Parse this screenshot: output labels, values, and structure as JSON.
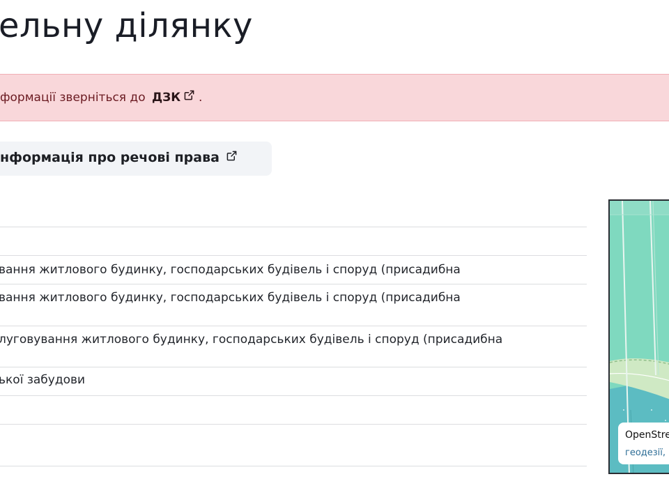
{
  "page": {
    "title": "ельну ділянку"
  },
  "alert": {
    "text": "формації зверніться до",
    "link_label": "ДЗК",
    "trailing": ".",
    "icon": "external-link-icon"
  },
  "rights_link": {
    "label": "нформація про речові права",
    "icon": "external-link-icon"
  },
  "details": {
    "rows": [
      "",
      "",
      "вання житлового будинку, господарських будівель і споруд (присадибна",
      "луговування житлового будинку, господарських будівель і споруд (присадибна",
      "ької забудови",
      "",
      ""
    ]
  },
  "map": {
    "attribution_title": "OpenStre",
    "attribution_sub": "геодезії,"
  },
  "colors": {
    "alert_bg": "#f9d7da",
    "alert_border": "#f1aeb5",
    "pill_bg": "#f2f4f7",
    "map_parcel": "#7fd9bf",
    "map_road": "#cfe9c4",
    "map_water": "#5cbcc2"
  }
}
